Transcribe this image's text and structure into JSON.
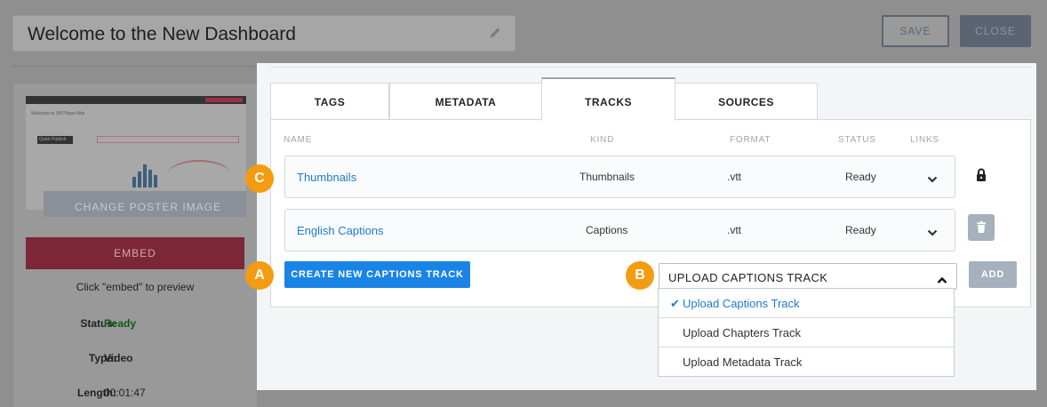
{
  "header": {
    "title": "Welcome to the New Dashboard",
    "save_label": "SAVE",
    "close_label": "CLOSE"
  },
  "sidebar": {
    "change_poster_label": "CHANGE POSTER IMAGE",
    "embed_label": "EMBED",
    "preview_hint": "Click \"embed\" to preview",
    "details": [
      {
        "key": "Status:",
        "value": "Ready"
      },
      {
        "key": "Type:",
        "value": "Video"
      },
      {
        "key": "Length:",
        "value": "00:01:47"
      }
    ]
  },
  "modal": {
    "tabs": [
      {
        "label": "TAGS",
        "active": false
      },
      {
        "label": "METADATA",
        "active": false
      },
      {
        "label": "TRACKS",
        "active": true
      },
      {
        "label": "SOURCES",
        "active": false
      }
    ],
    "columns": [
      "NAME",
      "KIND",
      "FORMAT",
      "STATUS",
      "LINKS"
    ],
    "tracks": [
      {
        "name": "Thumbnails",
        "kind": "Thumbnails",
        "format": ".vtt",
        "status": "Ready",
        "action_icon": "lock-icon"
      },
      {
        "name": "English Captions",
        "kind": "Captions",
        "format": ".vtt",
        "status": "Ready",
        "action_icon": "trash-icon"
      }
    ],
    "create_button_label": "CREATE NEW CAPTIONS TRACK",
    "select": {
      "value": "UPLOAD CAPTIONS TRACK",
      "options": [
        "Upload Captions Track",
        "Upload Chapters Track",
        "Upload Metadata Track"
      ],
      "selected_index": 0
    },
    "add_button_label": "ADD"
  },
  "markers": {
    "a": "A",
    "b": "B",
    "c": "C"
  },
  "colors": {
    "primary_blue": "#1a84e6",
    "link_blue": "#1e7bd0",
    "marker_orange": "#f39c12",
    "disabled_gray": "#a7b0bd",
    "embed_red": "#7d2638"
  }
}
